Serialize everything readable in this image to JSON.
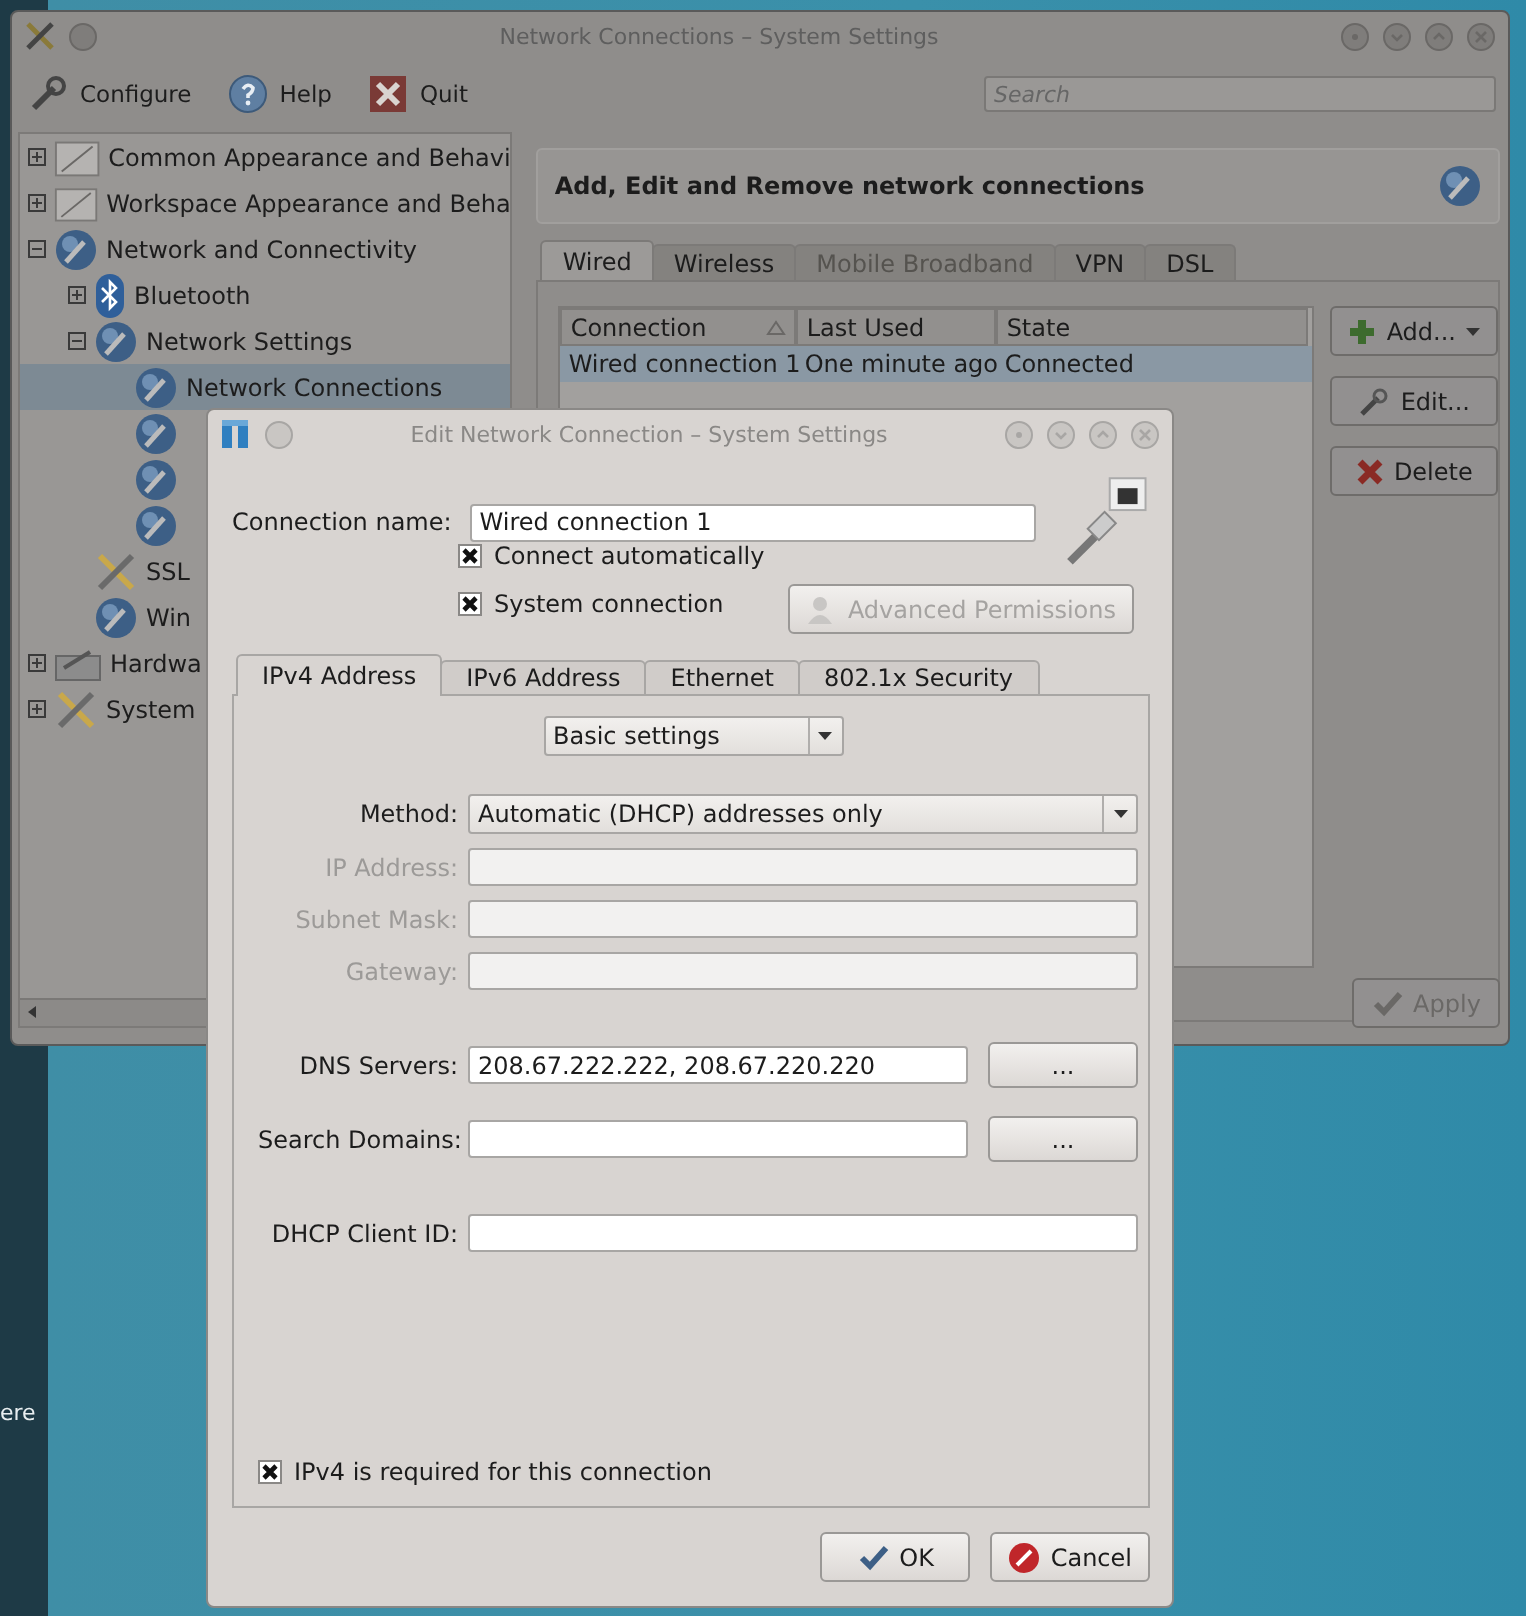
{
  "desktop": {
    "text": "ere"
  },
  "main_window": {
    "title": "Network Connections – System Settings",
    "toolbar": [
      {
        "label": "Configure",
        "kind": "configure"
      },
      {
        "label": "Help",
        "kind": "help"
      },
      {
        "label": "Quit",
        "kind": "quit"
      }
    ],
    "search": {
      "placeholder": "Search"
    },
    "sidebar": {
      "items": [
        {
          "label": "Common Appearance and Behavi",
          "kind": "appearance",
          "expanded": false,
          "selected": false
        },
        {
          "label": "Workspace Appearance and Beha",
          "kind": "appearance",
          "expanded": false,
          "selected": false
        },
        {
          "label": "Network and Connectivity",
          "kind": "globe",
          "expanded": true,
          "selected": false,
          "children": [
            {
              "label": "Bluetooth",
              "kind": "bluetooth",
              "expanded": false,
              "selected": false
            },
            {
              "label": "Network Settings",
              "kind": "globe",
              "expanded": true,
              "selected": false,
              "children": [
                {
                  "label": "Network Connections",
                  "kind": "globe",
                  "selected": true
                },
                {
                  "kind": "globe",
                  "selected": false
                },
                {
                  "kind": "globe",
                  "selected": false
                },
                {
                  "kind": "globe",
                  "selected": false
                }
              ]
            },
            {
              "label": "SSL",
              "kind": "tools",
              "selected": false
            },
            {
              "label": "Win",
              "kind": "globe",
              "selected": false
            }
          ]
        },
        {
          "label": "Hardwa",
          "kind": "hardware",
          "expanded": false,
          "selected": false
        },
        {
          "label": "System",
          "kind": "tools",
          "expanded": false,
          "selected": false
        }
      ]
    },
    "header": "Add, Edit and Remove network connections",
    "tabs": [
      {
        "label": "Wired",
        "selected": true,
        "disabled": false
      },
      {
        "label": "Wireless",
        "selected": false,
        "disabled": false
      },
      {
        "label": "Mobile Broadband",
        "selected": false,
        "disabled": true
      },
      {
        "label": "VPN",
        "selected": false,
        "disabled": false
      },
      {
        "label": "DSL",
        "selected": false,
        "disabled": false
      }
    ],
    "table": {
      "columns": [
        "Connection",
        "Last Used",
        "State"
      ],
      "rows": [
        {
          "cells": [
            "Wired connection 1",
            "One minute ago",
            "Connected"
          ],
          "selected": true
        }
      ]
    },
    "buttons": [
      {
        "label": "Add...",
        "kind": "add"
      },
      {
        "label": "Edit...",
        "kind": "edit"
      },
      {
        "label": "Delete",
        "kind": "delete"
      }
    ],
    "apply": {
      "label": "Apply",
      "disabled": true
    }
  },
  "dialog": {
    "title": "Edit Network Connection – System Settings",
    "connection_name": {
      "label": "Connection name:",
      "value": "Wired connection 1"
    },
    "checkboxes": [
      {
        "label": "Connect automatically",
        "checked": true
      },
      {
        "label": "System connection",
        "checked": true
      }
    ],
    "permissions_button": {
      "label": "Advanced Permissions",
      "disabled": true
    },
    "tabs": [
      {
        "label": "IPv4 Address",
        "selected": true
      },
      {
        "label": "IPv6 Address",
        "selected": false
      },
      {
        "label": "Ethernet",
        "selected": false
      },
      {
        "label": "802.1x Security",
        "selected": false
      }
    ],
    "mode": {
      "value": "Basic settings"
    },
    "field_groups": [
      [
        {
          "label": "Method:",
          "kind": "select",
          "value": "Automatic (DHCP) addresses only",
          "disabled": false
        },
        {
          "label": "IP Address:",
          "kind": "text",
          "disabled": true
        },
        {
          "label": "Subnet Mask:",
          "kind": "text",
          "disabled": true
        },
        {
          "label": "Gateway:",
          "kind": "text",
          "disabled": true
        }
      ],
      [
        {
          "label": "DNS Servers:",
          "kind": "text",
          "value": "208.67.222.222, 208.67.220.220",
          "button": "...",
          "disabled": false
        },
        {
          "label": "Search Domains:",
          "kind": "text",
          "button": "...",
          "disabled": false
        }
      ],
      [
        {
          "label": "DHCP Client ID:",
          "kind": "text",
          "disabled": false
        }
      ]
    ],
    "required": {
      "label": "IPv4 is required for this connection",
      "checked": true
    },
    "buttons": [
      {
        "label": "OK",
        "kind": "ok"
      },
      {
        "label": "Cancel",
        "kind": "cancel"
      }
    ]
  }
}
